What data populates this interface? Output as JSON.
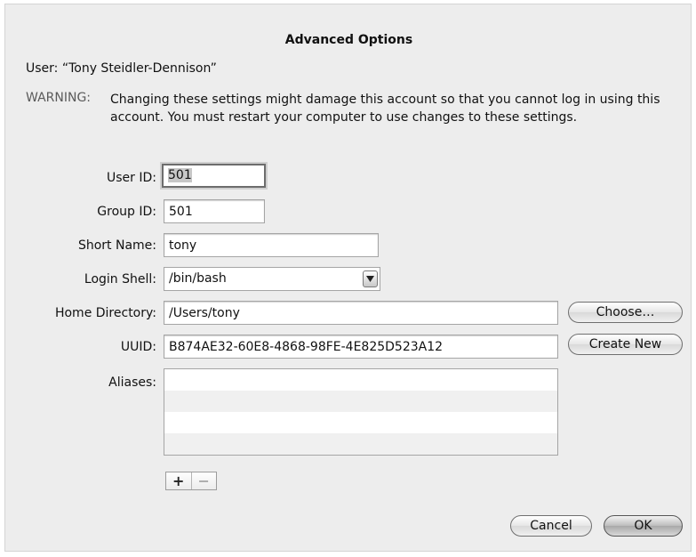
{
  "dialog": {
    "title": "Advanced Options",
    "user_line": "User: “Tony Steidler-Dennison”",
    "warning_label": "WARNING:",
    "warning_text": "Changing these settings might damage this account so that you cannot log in using this account. You must restart your computer to use changes to these settings."
  },
  "form": {
    "user_id": {
      "label": "User ID:",
      "value": "501"
    },
    "group_id": {
      "label": "Group ID:",
      "value": "501"
    },
    "short_name": {
      "label": "Short Name:",
      "value": "tony"
    },
    "login_shell": {
      "label": "Login Shell:",
      "value": "/bin/bash"
    },
    "home_directory": {
      "label": "Home Directory:",
      "value": "/Users/tony",
      "button": "Choose…"
    },
    "uuid": {
      "label": "UUID:",
      "value": "B874AE32-60E8-4868-98FE-4E825D523A12",
      "button": "Create New"
    },
    "aliases": {
      "label": "Aliases:",
      "items": []
    }
  },
  "alias_controls": {
    "add": "+",
    "remove": "−"
  },
  "buttons": {
    "cancel": "Cancel",
    "ok": "OK"
  },
  "icons": {
    "popup": "chevron-down-icon"
  }
}
